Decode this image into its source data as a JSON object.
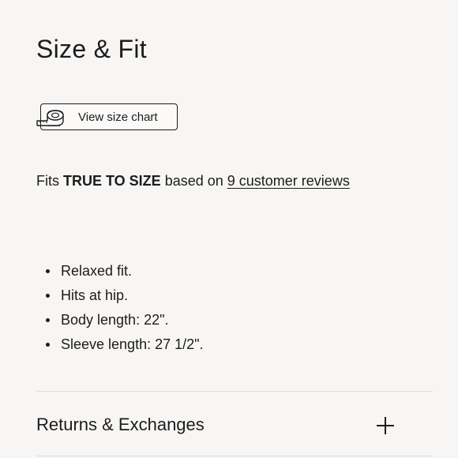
{
  "section": {
    "title": "Size & Fit"
  },
  "size_chart": {
    "label": "View size chart",
    "icon": "measuring-tape-icon"
  },
  "fit": {
    "prefix": "Fits ",
    "rating": "TRUE TO SIZE",
    "middle": " based on ",
    "reviews_link": "9 customer reviews"
  },
  "details": [
    "Relaxed fit.",
    "Hits at hip.",
    "Body length: 22\".",
    "Sleeve length: 27 1/2\"."
  ],
  "accordion": {
    "label": "Returns & Exchanges",
    "icon": "plus-icon"
  }
}
